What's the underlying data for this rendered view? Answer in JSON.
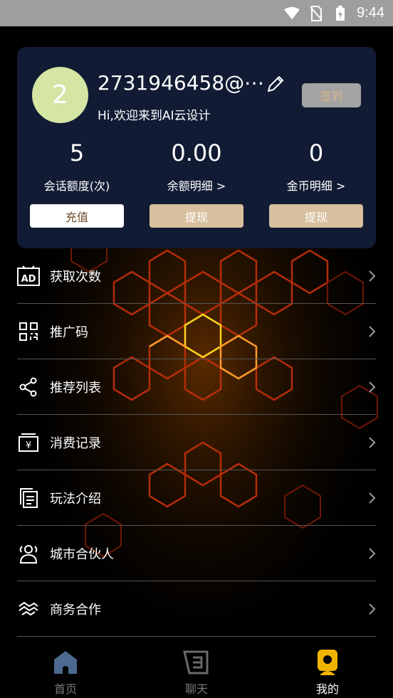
{
  "status_bar": {
    "time": "9:44"
  },
  "profile": {
    "avatar_text": "2",
    "username": "2731946458@⋯",
    "greeting": "Hi,欢迎来到AI云设计",
    "checkin_label": "签到"
  },
  "stats": [
    {
      "value": "5",
      "label": "会话额度(次)",
      "button": "充值"
    },
    {
      "value": "0.00",
      "label": "余额明细 >",
      "button": "提现"
    },
    {
      "value": "0",
      "label": "金币明细 >",
      "button": "提现"
    }
  ],
  "menu": [
    {
      "label": "获取次数",
      "icon": "ad-icon"
    },
    {
      "label": "推广码",
      "icon": "qr-code-icon"
    },
    {
      "label": "推荐列表",
      "icon": "share-icon"
    },
    {
      "label": "消费记录",
      "icon": "yen-receipt-icon"
    },
    {
      "label": "玩法介绍",
      "icon": "document-icon"
    },
    {
      "label": "城市合伙人",
      "icon": "partners-icon"
    },
    {
      "label": "商务合作",
      "icon": "handshake-icon"
    }
  ],
  "tabs": [
    {
      "label": "首页",
      "icon": "home-icon"
    },
    {
      "label": "聊天",
      "icon": "chat-icon"
    },
    {
      "label": "我的",
      "icon": "profile-icon"
    }
  ],
  "colors": {
    "card_bg": "#121b34",
    "avatar_bg": "#d4e5a4",
    "accent_gold": "#f0b400",
    "button_tan": "#d8bf9d"
  }
}
